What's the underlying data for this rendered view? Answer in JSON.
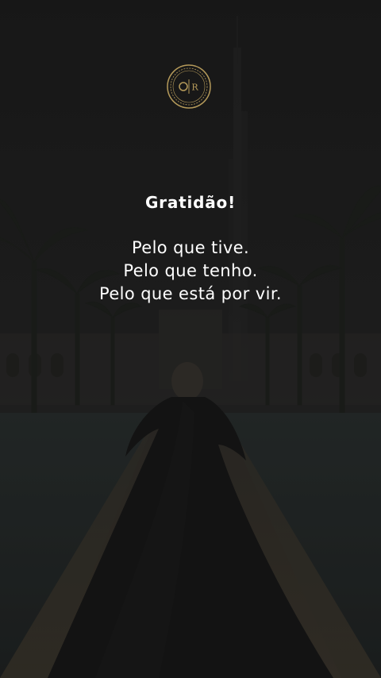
{
  "logo": {
    "letters": "OR",
    "accent_color": "#b59a5a"
  },
  "quote": {
    "heading": "Gratidão!",
    "lines": [
      "Pelo que tive.",
      "Pelo que tenho.",
      "Pelo que está por vir."
    ]
  },
  "colors": {
    "overlay": "#1c1c1c",
    "text": "#ffffff",
    "gold": "#b59a5a"
  }
}
